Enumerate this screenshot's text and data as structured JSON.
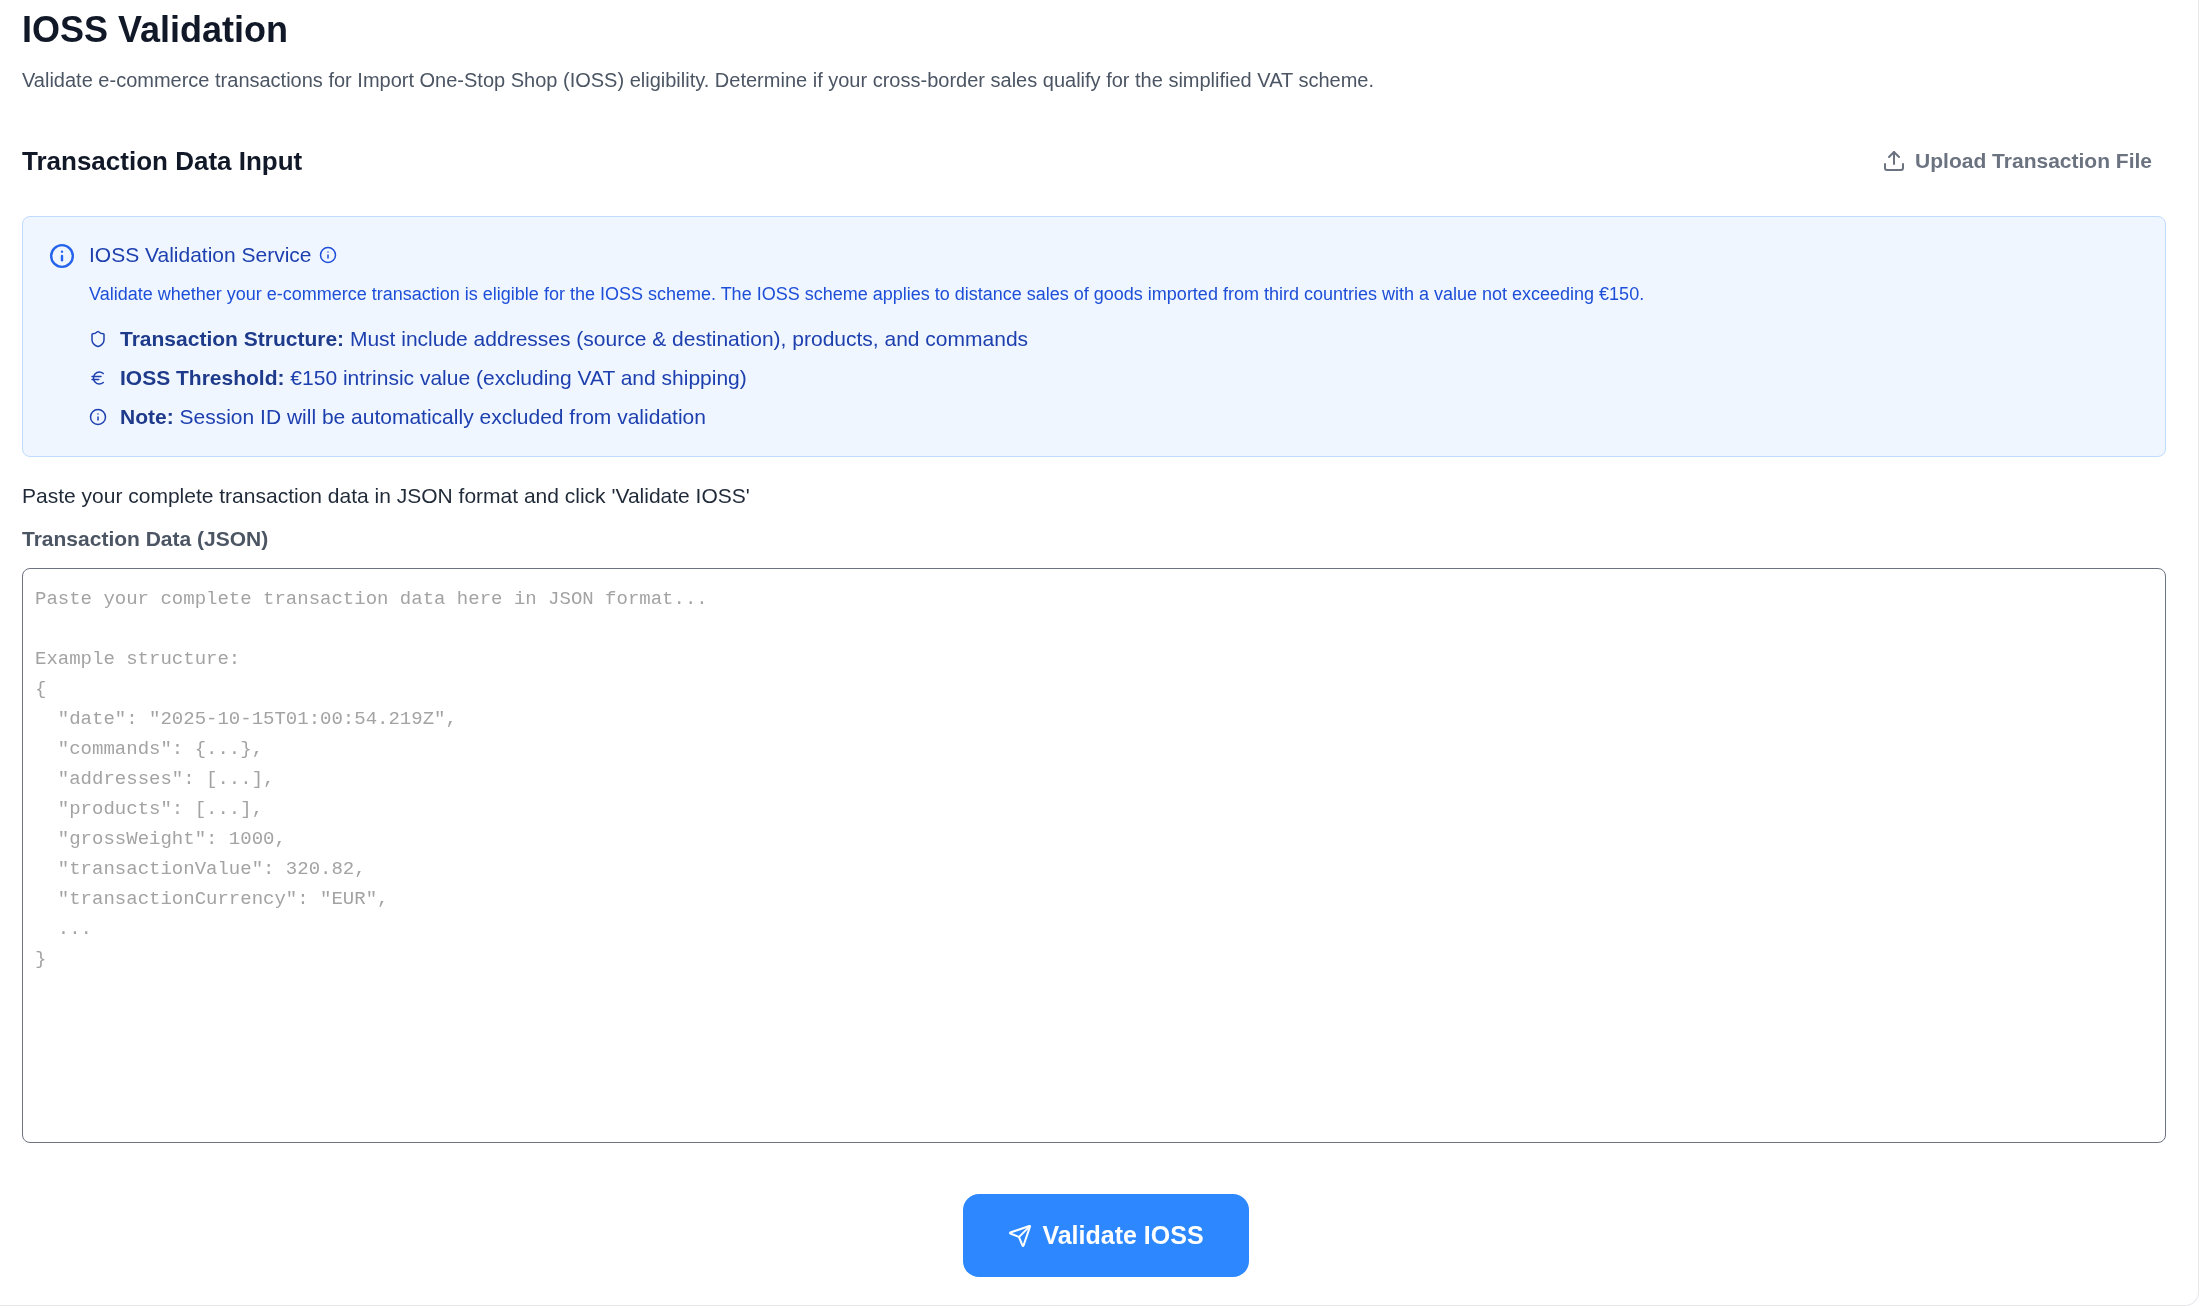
{
  "header": {
    "title": "IOSS Validation",
    "subtitle": "Validate e-commerce transactions for Import One-Stop Shop (IOSS) eligibility. Determine if your cross-border sales qualify for the simplified VAT scheme."
  },
  "section": {
    "title": "Transaction Data Input",
    "upload_button": "Upload Transaction File"
  },
  "info_panel": {
    "title": "IOSS Validation Service",
    "description": "Validate whether your e-commerce transaction is eligible for the IOSS scheme. The IOSS scheme applies to distance sales of goods imported from third countries with a value not exceeding €150.",
    "items": [
      "**Transaction Structure:** Must include addresses (source & destination), products, and commands",
      "**IOSS Threshold:** €150 intrinsic value (excluding VAT and shipping)",
      "**Note:** Session ID will be automatically excluded from validation"
    ]
  },
  "instructions": "Paste your complete transaction data in JSON format and click 'Validate IOSS'",
  "json_input": {
    "label": "Transaction Data (JSON)",
    "placeholder": "Paste your complete transaction data here in JSON format...\n\nExample structure:\n{\n  \"date\": \"2025-10-15T01:00:54.219Z\",\n  \"commands\": {...},\n  \"addresses\": [...],\n  \"products\": [...],\n  \"grossWeight\": 1000,\n  \"transactionValue\": 320.82,\n  \"transactionCurrency\": \"EUR\",\n  ...\n}"
  },
  "submit_button": "Validate IOSS"
}
